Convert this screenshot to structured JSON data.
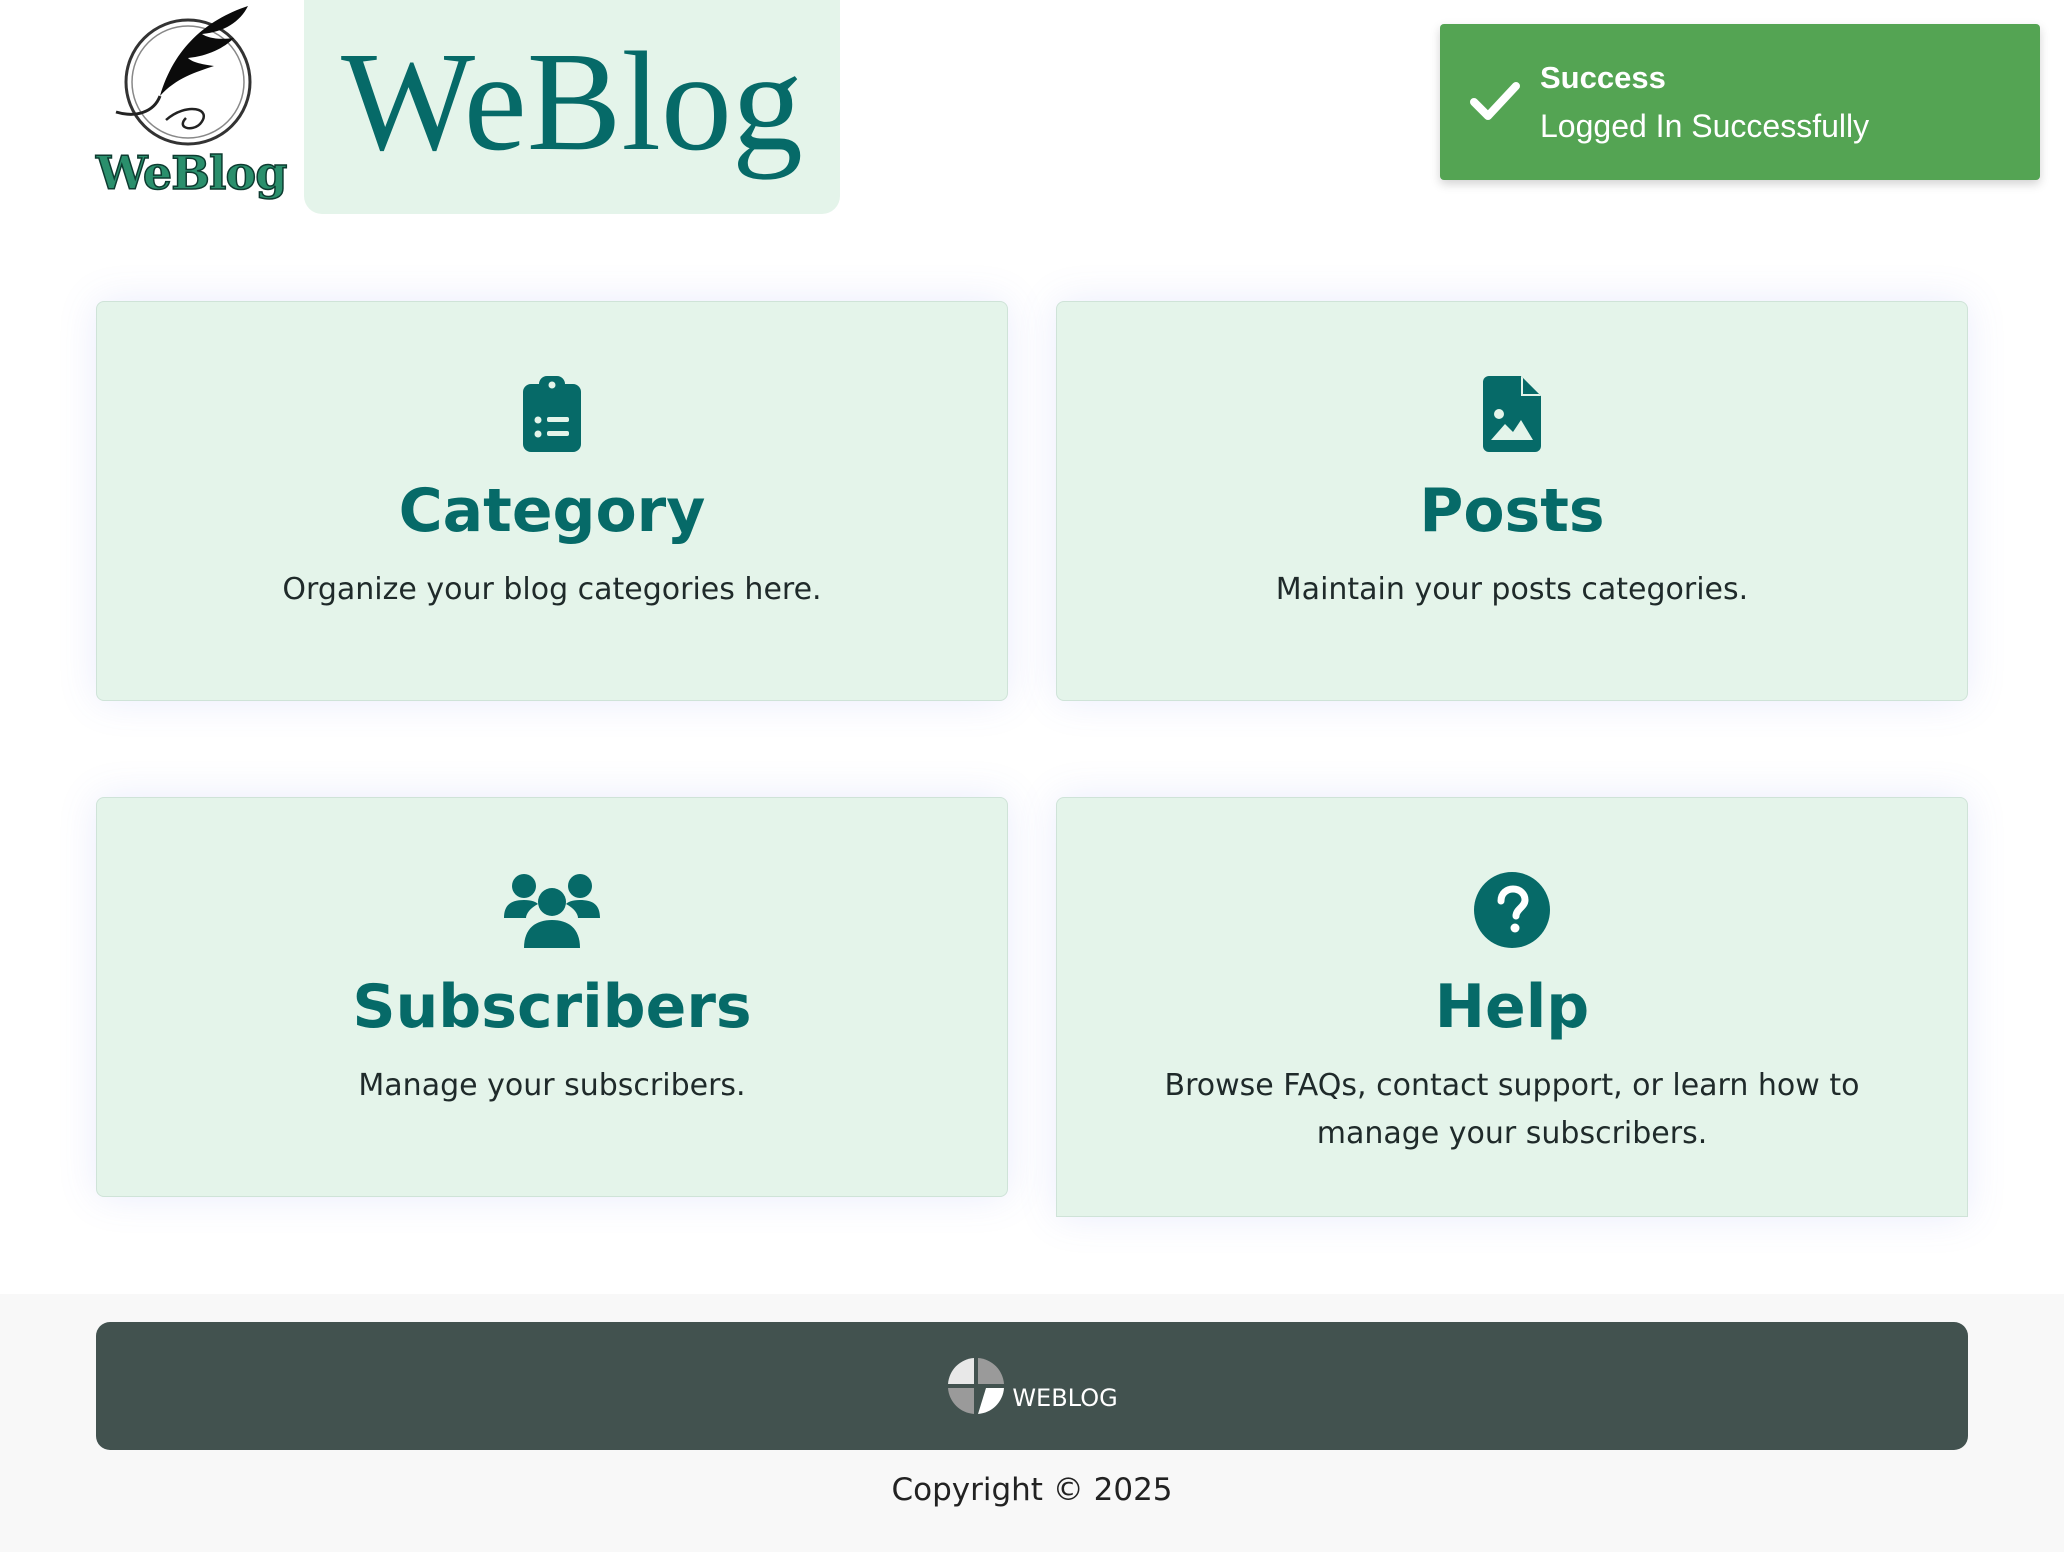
{
  "header": {
    "logo_text": "WeBlog",
    "title": "WeBlog"
  },
  "toast": {
    "title": "Success",
    "message": "Logged In Successfully",
    "icon": "check-icon",
    "color": "#54a453"
  },
  "cards": [
    {
      "icon": "clipboard-list-icon",
      "title": "Category",
      "description": "Organize your blog categories here."
    },
    {
      "icon": "file-image-icon",
      "title": "Posts",
      "description": "Maintain your posts categories."
    },
    {
      "icon": "users-icon",
      "title": "Subscribers",
      "description": "Manage your subscribers."
    },
    {
      "icon": "question-circle-icon",
      "title": "Help",
      "description": "Browse FAQs, contact support, or learn how to manage your subscribers."
    }
  ],
  "footer": {
    "logo_text": "WEBLOG",
    "copyright": "Copyright © 2025"
  },
  "colors": {
    "accent": "#066a68",
    "card_bg": "#e4f4ea",
    "footer_bar": "#42524f"
  }
}
